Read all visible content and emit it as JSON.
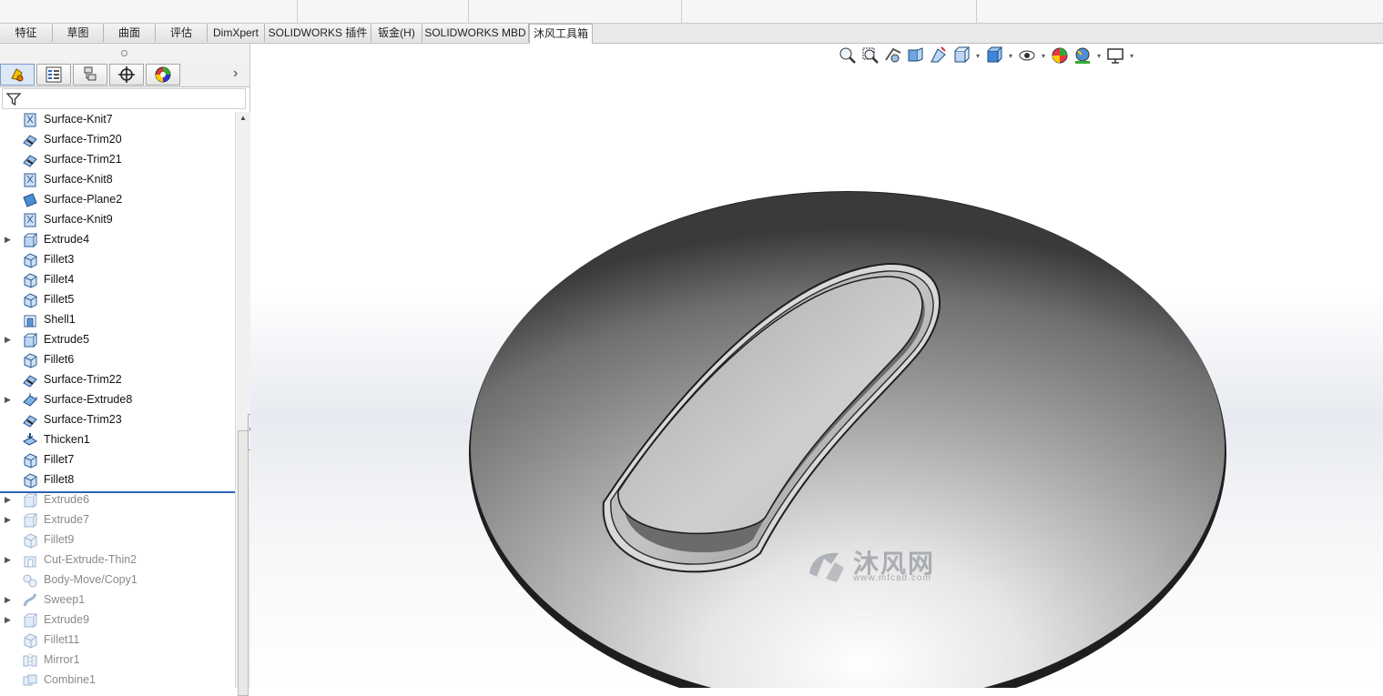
{
  "command_tabs": [
    {
      "label": "特征",
      "width": 57
    },
    {
      "label": "草图",
      "width": 55
    },
    {
      "label": "曲面",
      "width": 56
    },
    {
      "label": "评估",
      "width": 56
    },
    {
      "label": "DimXpert",
      "width": 62
    },
    {
      "label": "SOLIDWORKS 插件",
      "width": 116
    },
    {
      "label": "钣金(H)",
      "width": 55
    },
    {
      "label": "SOLIDWORKS MBD",
      "width": 116
    },
    {
      "label": "沐风工具箱",
      "width": 68,
      "active": true
    }
  ],
  "panel_tabs": [
    "FeatureManager",
    "PropertyManager",
    "ConfigurationManager",
    "DimXpertManager",
    "DisplayManager"
  ],
  "feature_tree": [
    {
      "label": "Surface-Knit7",
      "icon": "surface-knit-icon",
      "expand": false,
      "suppressed": false
    },
    {
      "label": "Surface-Trim20",
      "icon": "surface-trim-icon",
      "expand": false,
      "suppressed": false
    },
    {
      "label": "Surface-Trim21",
      "icon": "surface-trim-icon",
      "expand": false,
      "suppressed": false
    },
    {
      "label": "Surface-Knit8",
      "icon": "surface-knit-icon",
      "expand": false,
      "suppressed": false
    },
    {
      "label": "Surface-Plane2",
      "icon": "surface-plane-icon",
      "expand": false,
      "suppressed": false
    },
    {
      "label": "Surface-Knit9",
      "icon": "surface-knit-icon",
      "expand": false,
      "suppressed": false
    },
    {
      "label": "Extrude4",
      "icon": "extrude-icon",
      "expand": true,
      "suppressed": false
    },
    {
      "label": "Fillet3",
      "icon": "fillet-icon",
      "expand": false,
      "suppressed": false
    },
    {
      "label": "Fillet4",
      "icon": "fillet-icon",
      "expand": false,
      "suppressed": false
    },
    {
      "label": "Fillet5",
      "icon": "fillet-icon",
      "expand": false,
      "suppressed": false
    },
    {
      "label": "Shell1",
      "icon": "shell-icon",
      "expand": false,
      "suppressed": false
    },
    {
      "label": "Extrude5",
      "icon": "extrude-icon",
      "expand": true,
      "suppressed": false
    },
    {
      "label": "Fillet6",
      "icon": "fillet-icon",
      "expand": false,
      "suppressed": false
    },
    {
      "label": "Surface-Trim22",
      "icon": "surface-trim-icon",
      "expand": false,
      "suppressed": false
    },
    {
      "label": "Surface-Extrude8",
      "icon": "surface-extrude-icon",
      "expand": true,
      "suppressed": false
    },
    {
      "label": "Surface-Trim23",
      "icon": "surface-trim-icon",
      "expand": false,
      "suppressed": false
    },
    {
      "label": "Thicken1",
      "icon": "thicken-icon",
      "expand": false,
      "suppressed": false
    },
    {
      "label": "Fillet7",
      "icon": "fillet-icon",
      "expand": false,
      "suppressed": false
    },
    {
      "label": "Fillet8",
      "icon": "fillet-icon",
      "expand": false,
      "suppressed": false
    },
    {
      "label": "Extrude6",
      "icon": "extrude-icon",
      "expand": true,
      "suppressed": true
    },
    {
      "label": "Extrude7",
      "icon": "extrude-icon",
      "expand": true,
      "suppressed": true
    },
    {
      "label": "Fillet9",
      "icon": "fillet-icon",
      "expand": false,
      "suppressed": true
    },
    {
      "label": "Cut-Extrude-Thin2",
      "icon": "cut-extrude-icon",
      "expand": true,
      "suppressed": true
    },
    {
      "label": "Body-Move/Copy1",
      "icon": "body-move-icon",
      "expand": false,
      "suppressed": true
    },
    {
      "label": "Sweep1",
      "icon": "sweep-icon",
      "expand": true,
      "suppressed": true
    },
    {
      "label": "Extrude9",
      "icon": "extrude-icon",
      "expand": true,
      "suppressed": true
    },
    {
      "label": "Fillet11",
      "icon": "fillet-icon",
      "expand": false,
      "suppressed": true
    },
    {
      "label": "Mirror1",
      "icon": "mirror-icon",
      "expand": false,
      "suppressed": true
    },
    {
      "label": "Combine1",
      "icon": "combine-icon",
      "expand": false,
      "suppressed": true
    }
  ],
  "heads_up_toolbar": [
    {
      "name": "zoom-to-fit-icon",
      "dropdown": false
    },
    {
      "name": "zoom-to-area-icon",
      "dropdown": false
    },
    {
      "name": "previous-view-icon",
      "dropdown": false
    },
    {
      "name": "section-view-icon",
      "dropdown": false
    },
    {
      "name": "dynamic-annotation-icon",
      "dropdown": false
    },
    {
      "name": "view-orientation-icon",
      "dropdown": true
    },
    {
      "name": "display-style-icon",
      "dropdown": true
    },
    {
      "name": "hide-show-items-icon",
      "dropdown": true
    },
    {
      "name": "edit-appearance-icon",
      "dropdown": false
    },
    {
      "name": "apply-scene-icon",
      "dropdown": true
    },
    {
      "name": "view-settings-icon",
      "dropdown": true
    }
  ],
  "watermark": {
    "brand": "沐风网",
    "url": "www.mfcad.com"
  },
  "colors": {
    "accent": "#2b63b8",
    "tab_active": "#ffffff",
    "model_dark": "#2a2a2a"
  }
}
